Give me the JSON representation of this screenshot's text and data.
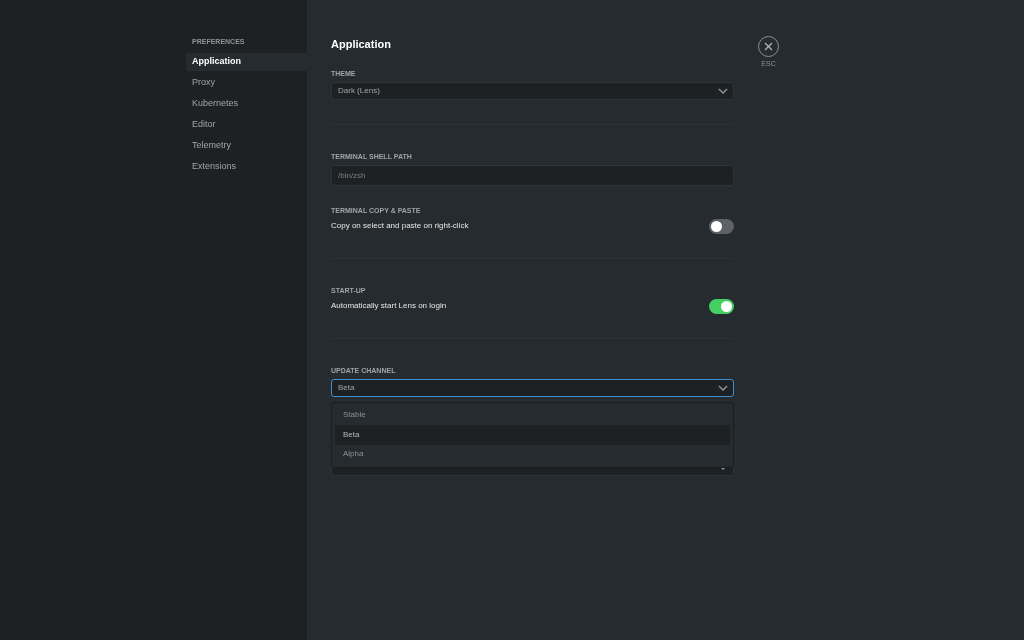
{
  "sidebar": {
    "heading": "PREFERENCES",
    "items": [
      {
        "label": "Application",
        "selected": true
      },
      {
        "label": "Proxy",
        "selected": false
      },
      {
        "label": "Kubernetes",
        "selected": false
      },
      {
        "label": "Editor",
        "selected": false
      },
      {
        "label": "Telemetry",
        "selected": false
      },
      {
        "label": "Extensions",
        "selected": false
      }
    ]
  },
  "page": {
    "title": "Application"
  },
  "close": {
    "label": "ESC"
  },
  "sections": [
    {
      "kind": "select",
      "label": "THEME",
      "value": "Dark (Lens)",
      "focused": false
    },
    {
      "kind": "divider"
    },
    {
      "kind": "input",
      "label": "TERMINAL SHELL PATH",
      "placeholder": "/bin/zsh"
    },
    {
      "kind": "toggle",
      "label": "TERMINAL COPY & PASTE",
      "text": "Copy on select and paste on right-click",
      "on": false
    },
    {
      "kind": "divider"
    },
    {
      "kind": "toggle",
      "label": "START-UP",
      "text": "Automatically start Lens on login",
      "on": true
    },
    {
      "kind": "divider"
    },
    {
      "kind": "select",
      "label": "UPDATE CHANNEL",
      "value": "Beta",
      "focused": true,
      "options": [
        {
          "label": "Stable",
          "selected": false
        },
        {
          "label": "Beta",
          "selected": true
        },
        {
          "label": "Alpha",
          "selected": false
        }
      ]
    },
    {
      "kind": "select",
      "focused": false
    }
  ]
}
